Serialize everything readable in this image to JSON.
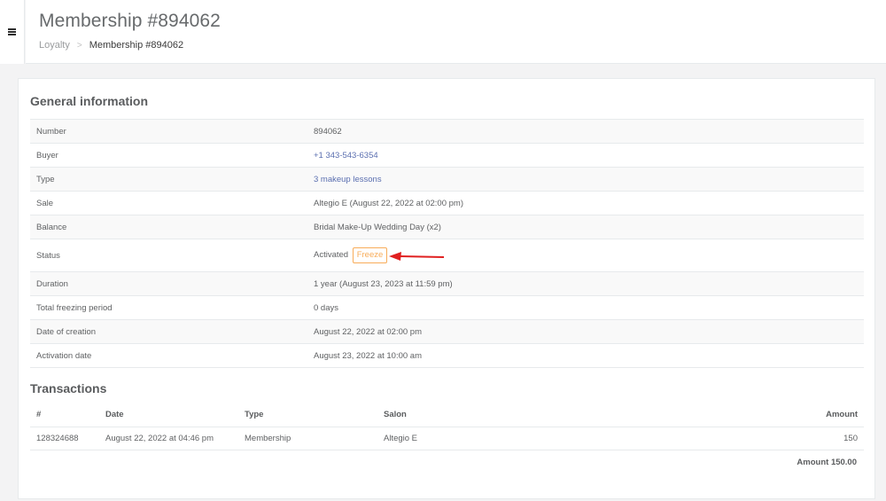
{
  "header": {
    "title": "Membership #894062",
    "breadcrumb": {
      "parent": "Loyalty",
      "separator": ">",
      "current": "Membership #894062"
    }
  },
  "general": {
    "title": "General information",
    "rows": {
      "number": {
        "label": "Number",
        "value": "894062"
      },
      "buyer": {
        "label": "Buyer",
        "value": "+1 343-543-6354"
      },
      "type": {
        "label": "Type",
        "value": "3 makeup lessons"
      },
      "sale": {
        "label": "Sale",
        "value": "Altegio E (August 22, 2022 at 02:00 pm)"
      },
      "balance": {
        "label": "Balance",
        "value": "Bridal Make-Up Wedding Day (x2)"
      },
      "status": {
        "label": "Status",
        "value": "Activated",
        "action_label": "Freeze"
      },
      "duration": {
        "label": "Duration",
        "value": "1 year (August 23, 2023 at 11:59 pm)"
      },
      "freezing": {
        "label": "Total freezing period",
        "value": "0 days"
      },
      "created": {
        "label": "Date of creation",
        "value": "August 22, 2022 at 02:00 pm"
      },
      "activated": {
        "label": "Activation date",
        "value": "August 23, 2022 at 10:00 am"
      }
    }
  },
  "transactions": {
    "title": "Transactions",
    "columns": {
      "id": "#",
      "date": "Date",
      "type": "Type",
      "salon": "Salon",
      "amount": "Amount"
    },
    "rows": [
      {
        "id": "128324688",
        "date": "August 22, 2022 at 04:46 pm",
        "type": "Membership",
        "salon": "Altegio E",
        "amount": "150"
      }
    ],
    "total": "Amount 150.00"
  },
  "colors": {
    "link": "#5b6fb0",
    "freeze": "#f8ac59",
    "annotation_arrow": "#e02020"
  },
  "icons": {
    "menu": "hamburger-menu-icon"
  }
}
